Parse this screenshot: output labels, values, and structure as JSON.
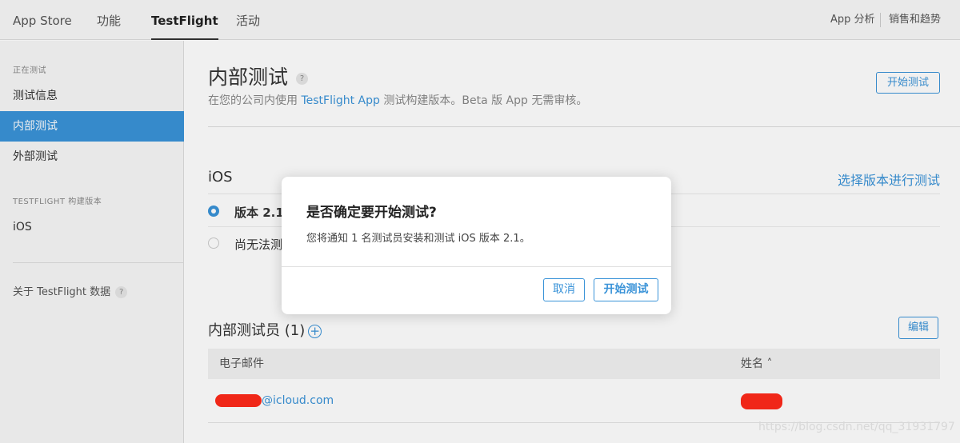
{
  "topnav": {
    "tabs": [
      {
        "label": "App Store"
      },
      {
        "label": "功能"
      },
      {
        "label": "TestFlight"
      },
      {
        "label": "活动"
      }
    ],
    "right_links": [
      {
        "label": "App 分析"
      },
      {
        "label": "销售和趋势"
      }
    ]
  },
  "sidebar": {
    "section_testing": "正在测试",
    "items_testing": [
      {
        "label": "测试信息"
      },
      {
        "label": "内部测试"
      },
      {
        "label": "外部测试"
      }
    ],
    "section_builds": "TESTFLIGHT 构建版本",
    "items_builds": [
      {
        "label": "iOS"
      }
    ],
    "about": "关于 TestFlight 数据",
    "about_help": "?"
  },
  "main": {
    "title": "内部测试",
    "title_help": "?",
    "subtitle_prefix": "在您的公司内使用 ",
    "subtitle_link": "TestFlight App",
    "subtitle_suffix": " 测试构建版本。Beta 版 App 无需审核。",
    "start_button": "开始测试",
    "platform_title": "iOS",
    "select_build_link": "选择版本进行测试",
    "options": [
      {
        "label": "版本 2.1",
        "selected": true
      },
      {
        "label": "尚无法测",
        "selected": false
      }
    ],
    "testers_title": "内部测试员 (1)",
    "add_icon": "+",
    "edit_button": "编辑",
    "table": {
      "columns": [
        "电子邮件",
        "姓名 ˄"
      ],
      "rows": [
        {
          "email_domain": "@icloud.com"
        }
      ]
    }
  },
  "dialog": {
    "title": "是否确定要开始测试?",
    "message": "您将通知 1 名测试员安装和测试 iOS 版本 2.1。",
    "cancel": "取消",
    "confirm": "开始测试"
  },
  "watermark": "https://blog.csdn.net/qq_31931797",
  "colors": {
    "accent": "#3a93d8",
    "redaction": "#ff2a1a"
  }
}
